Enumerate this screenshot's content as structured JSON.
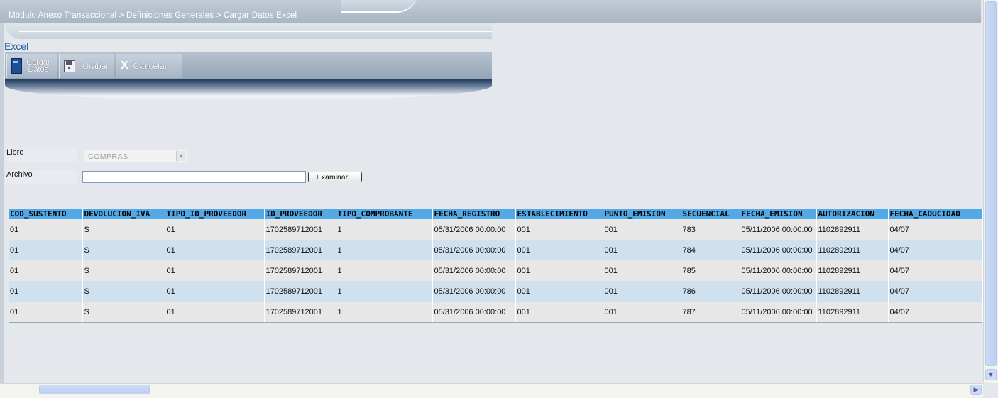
{
  "breadcrumb": "Módulo Anexo Transaccional > Definiciones Generales > Cargar Datos Excel",
  "page_title": "Excel",
  "toolbar": {
    "cargar_line1": "Cargar",
    "cargar_line2": "Datos",
    "grabar": "Grabar",
    "cancelar": "Cancelar"
  },
  "form": {
    "libro_label": "Libro",
    "libro_value": "COMPRAS",
    "archivo_label": "Archivo",
    "archivo_value": "",
    "browse_label": "Examinar..."
  },
  "table": {
    "headers": [
      "COD_SUSTENTO",
      "DEVOLUCION_IVA",
      "TIPO_ID_PROVEEDOR",
      "ID_PROVEEDOR",
      "TIPO_COMPROBANTE",
      "FECHA_REGISTRO",
      "ESTABLECIMIENTO",
      "PUNTO_EMISION",
      "SECUENCIAL",
      "FECHA_EMISION",
      "AUTORIZACION",
      "FECHA_CADUCIDAD"
    ],
    "rows": [
      [
        "01",
        "S",
        "01",
        "1702589712001",
        "1",
        "05/31/2006 00:00:00",
        "001",
        "001",
        "783",
        "05/11/2006 00:00:00",
        "1102892911",
        "04/07"
      ],
      [
        "01",
        "S",
        "01",
        "1702589712001",
        "1",
        "05/31/2006 00:00:00",
        "001",
        "001",
        "784",
        "05/11/2006 00:00:00",
        "1102892911",
        "04/07"
      ],
      [
        "01",
        "S",
        "01",
        "1702589712001",
        "1",
        "05/31/2006 00:00:00",
        "001",
        "001",
        "785",
        "05/11/2006 00:00:00",
        "1102892911",
        "04/07"
      ],
      [
        "01",
        "S",
        "01",
        "1702589712001",
        "1",
        "05/31/2006 00:00:00",
        "001",
        "001",
        "786",
        "05/11/2006 00:00:00",
        "1102892911",
        "04/07"
      ],
      [
        "01",
        "S",
        "01",
        "1702589712001",
        "1",
        "05/31/2006 00:00:00",
        "001",
        "001",
        "787",
        "05/11/2006 00:00:00",
        "1102892911",
        "04/07"
      ]
    ]
  },
  "icons": {
    "cargar": "spreadsheet-icon",
    "grabar": "save-icon",
    "cancelar": "close-icon"
  },
  "colors": {
    "header_bg": "#53a8e6",
    "row_odd": "#e7e7e7",
    "row_even": "#cfe0ee",
    "title": "#1f5fa6"
  }
}
